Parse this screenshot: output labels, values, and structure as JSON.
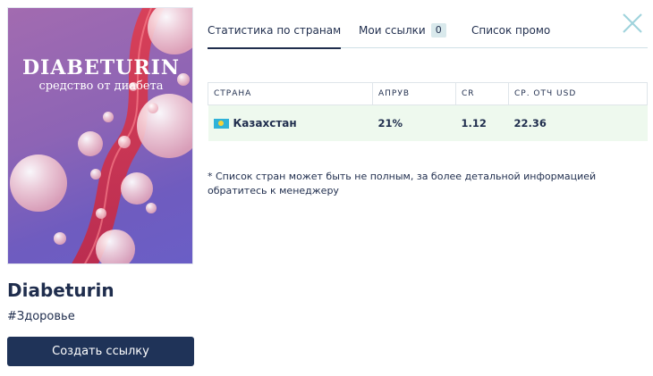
{
  "product": {
    "image_title": "DIABETURIN",
    "image_subtitle": "средство от диабета",
    "name": "Diabeturin",
    "category": "#Здоровье",
    "create_link_label": "Создать ссылку"
  },
  "tabs": {
    "stats_label": "Статистика по странам",
    "links_label": "Мои ссылки",
    "links_count": "0",
    "promo_label": "Список промо"
  },
  "table": {
    "headers": [
      "СТРАНА",
      "АПРУВ",
      "CR",
      "СР. ОТЧ USD"
    ],
    "rows": [
      {
        "country": "Казахстан",
        "flag": "kz-flag",
        "approve": "21%",
        "cr": "1.12",
        "avg_usd": "22.36"
      }
    ]
  },
  "note": "* Список стран может быть не полным, за более детальной информацией обратитесь к менеджеру",
  "icons": {
    "close": "close-icon"
  },
  "colors": {
    "primary": "#1f3358",
    "row_bg": "#eef9ee",
    "accent": "#9fd3dc"
  }
}
